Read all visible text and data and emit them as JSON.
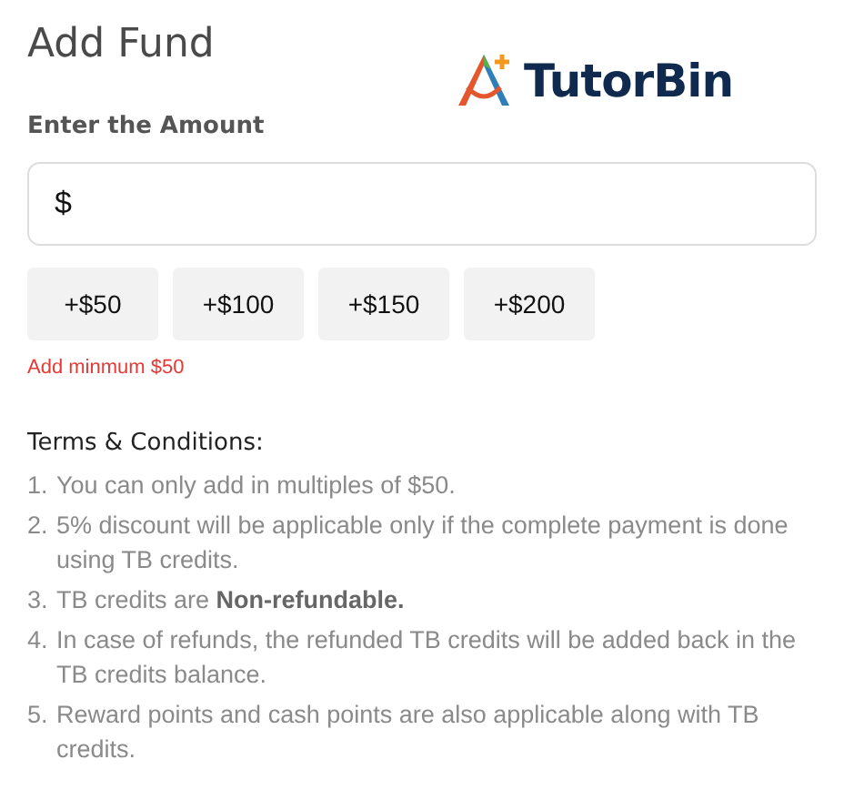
{
  "title": "Add Fund",
  "logo": {
    "text": "TutorBin"
  },
  "amount_label": "Enter the Amount",
  "amount_field": {
    "value": "$"
  },
  "quick_amounts": [
    "+$50",
    "+$100",
    "+$150",
    "+$200"
  ],
  "error": "Add minmum $50",
  "terms": {
    "heading": "Terms & Conditions:",
    "items": [
      {
        "number": "1.",
        "text": "You can only add in multiples of $50."
      },
      {
        "number": "2.",
        "text": "5% discount will be applicable only if the complete payment is done using TB credits."
      },
      {
        "number": "3.",
        "text": "TB credits are **Non-refundable.**"
      },
      {
        "number": "4.",
        "text": "In case of refunds, the refunded TB credits will be added back in the TB credits balance."
      },
      {
        "number": "5.",
        "text": "Reward points and cash points are also applicable along with TB credits."
      }
    ]
  }
}
